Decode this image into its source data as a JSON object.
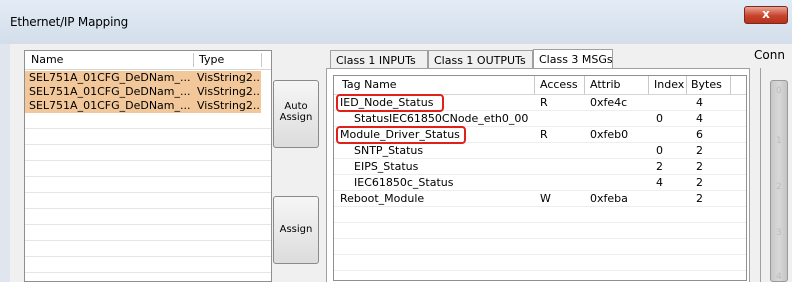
{
  "window": {
    "title": "Ethernet/IP Mapping",
    "close_glyph": "x"
  },
  "left_table": {
    "headers": {
      "name": "Name",
      "type": "Type"
    },
    "rows": [
      {
        "name": "SEL751A_01CFG_DeDNam_...",
        "type": "VisString2..."
      },
      {
        "name": "SEL751A_01CFG_DeDNam_...",
        "type": "VisString2..."
      },
      {
        "name": "SEL751A_01CFG_DeDNam_...",
        "type": "VisString2..."
      }
    ],
    "row_highlight": "#f2c89a"
  },
  "buttons": {
    "auto_assign_line1": "Auto",
    "auto_assign_line2": "Assign",
    "assign": "Assign"
  },
  "tabs": [
    {
      "label": "Class 1 INPUTs",
      "active": false
    },
    {
      "label": "Class 1 OUTPUTs",
      "active": false
    },
    {
      "label": "Class 3 MSGs",
      "active": true
    }
  ],
  "grid": {
    "headers": {
      "tag": "Tag Name",
      "access": "Access",
      "attrib": "Attrib",
      "index": "Index",
      "bytes": "Bytes"
    },
    "rows": [
      {
        "tag": "IED_Node_Status",
        "indent": false,
        "access": "R",
        "attrib": "0xfe4c",
        "index": "",
        "bytes": "4",
        "highlighted": true
      },
      {
        "tag": "StatusIEC61850CNode_eth0_00",
        "indent": true,
        "access": "",
        "attrib": "",
        "index": "0",
        "bytes": "4",
        "highlighted": false
      },
      {
        "tag": "Module_Driver_Status",
        "indent": false,
        "access": "R",
        "attrib": "0xfeb0",
        "index": "",
        "bytes": "6",
        "highlighted": true
      },
      {
        "tag": "SNTP_Status",
        "indent": true,
        "access": "",
        "attrib": "",
        "index": "0",
        "bytes": "2",
        "highlighted": false
      },
      {
        "tag": "EIPS_Status",
        "indent": true,
        "access": "",
        "attrib": "",
        "index": "2",
        "bytes": "2",
        "highlighted": false
      },
      {
        "tag": "IEC61850c_Status",
        "indent": true,
        "access": "",
        "attrib": "",
        "index": "4",
        "bytes": "2",
        "highlighted": false
      },
      {
        "tag": "Reboot_Module",
        "indent": false,
        "access": "W",
        "attrib": "0xfeba",
        "index": "",
        "bytes": "2",
        "highlighted": false
      }
    ],
    "highlight_color": "#e0201b"
  },
  "connections": {
    "label": "Conn",
    "ticks": [
      "0",
      "1",
      "2",
      "3",
      "4"
    ]
  }
}
